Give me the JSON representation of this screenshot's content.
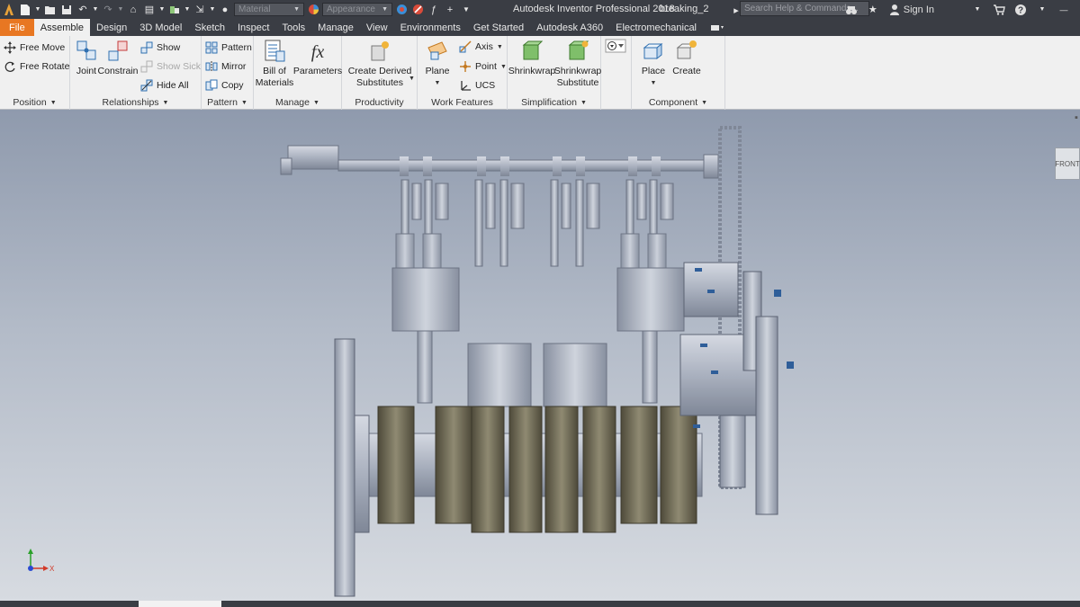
{
  "window": {
    "app_title": "Autodesk Inventor Professional 2018",
    "doc_name": "breaking_2"
  },
  "qat": {
    "material_placeholder": "Material",
    "appearance_placeholder": "Appearance"
  },
  "search": {
    "placeholder": "Search Help & Commands..."
  },
  "user": {
    "sign_in": "Sign In"
  },
  "tabs": [
    {
      "label": "File"
    },
    {
      "label": "Assemble"
    },
    {
      "label": "Design"
    },
    {
      "label": "3D Model"
    },
    {
      "label": "Sketch"
    },
    {
      "label": "Inspect"
    },
    {
      "label": "Tools"
    },
    {
      "label": "Manage"
    },
    {
      "label": "View"
    },
    {
      "label": "Environments"
    },
    {
      "label": "Get Started"
    },
    {
      "label": "Autodesk A360"
    },
    {
      "label": "Electromechanical"
    }
  ],
  "ribbon": {
    "position": {
      "label": "Position",
      "free_move": "Free Move",
      "free_rotate": "Free Rotate"
    },
    "relationships": {
      "label": "Relationships",
      "joint": "Joint",
      "constrain": "Constrain",
      "show": "Show",
      "show_sick": "Show Sick",
      "hide_all": "Hide All"
    },
    "pattern": {
      "label": "Pattern",
      "pattern": "Pattern",
      "mirror": "Mirror",
      "copy": "Copy"
    },
    "manage": {
      "label": "Manage",
      "bom_line1": "Bill of",
      "bom_line2": "Materials",
      "parameters": "Parameters"
    },
    "productivity": {
      "label": "Productivity",
      "cds_line1": "Create Derived",
      "cds_line2": "Substitutes"
    },
    "work_features": {
      "label": "Work Features",
      "plane": "Plane",
      "axis": "Axis",
      "point": "Point",
      "ucs": "UCS"
    },
    "simplification": {
      "label": "Simplification",
      "shrinkwrap": "Shrinkwrap",
      "sws_line1": "Shrinkwrap",
      "sws_line2": "Substitute"
    },
    "component": {
      "label": "Component",
      "place": "Place",
      "create": "Create"
    }
  },
  "viewcube": {
    "label": "FRONT"
  },
  "triad": {
    "x_label": "X"
  },
  "colors": {
    "file_tab": "#e87722",
    "accent_blue": "#2f6fb0",
    "chrome": "#3a3d44"
  }
}
